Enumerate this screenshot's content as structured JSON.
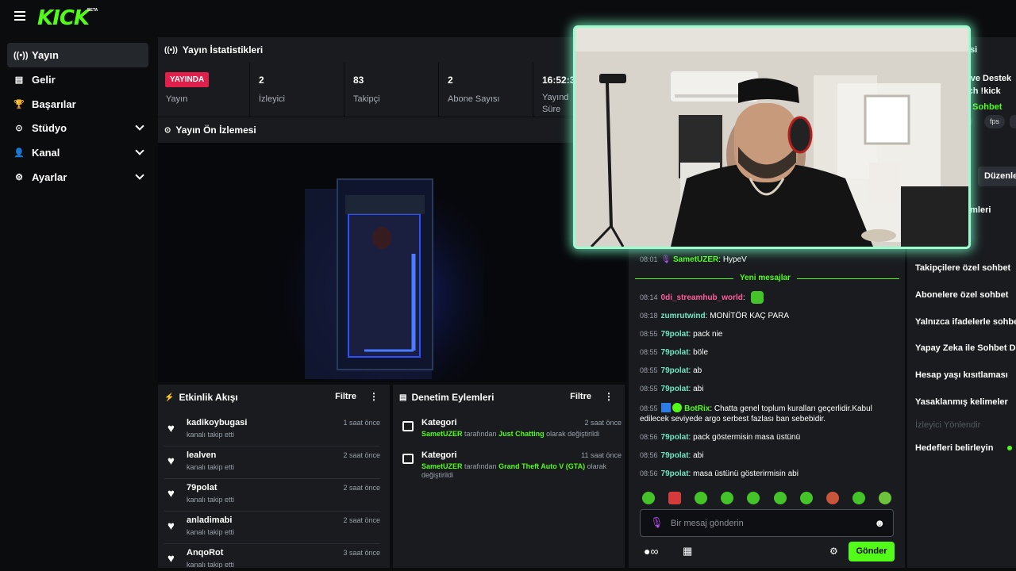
{
  "brand": {
    "logo": "KICK",
    "badge": "BETA"
  },
  "sidebar": {
    "items": [
      {
        "label": "Yayın",
        "icon": "broadcast-icon",
        "active": true
      },
      {
        "label": "Gelir",
        "icon": "revenue-icon"
      },
      {
        "label": "Başarılar",
        "icon": "trophy-icon"
      },
      {
        "label": "Stüdyo",
        "icon": "studio-icon",
        "expandable": true
      },
      {
        "label": "Kanal",
        "icon": "channel-icon",
        "expandable": true
      },
      {
        "label": "Ayarlar",
        "icon": "gear-icon",
        "expandable": true
      }
    ]
  },
  "stats": {
    "title": "Yayın İstatistikleri",
    "live_badge": "YAYINDA",
    "live_label": "Yayın",
    "viewers": {
      "value": "2",
      "label": "İzleyici"
    },
    "followers": {
      "value": "83",
      "label": "Takipçi"
    },
    "subs": {
      "value": "2",
      "label": "Abone Sayısı"
    },
    "duration": {
      "value": "16:52:3",
      "label1": "Yayınd",
      "label2": "Süre"
    }
  },
  "preview": {
    "title": "Yayın Ön İzlemesi"
  },
  "activity": {
    "title": "Etkinlik Akışı",
    "filter": "Filtre",
    "rows": [
      {
        "name": "kadikoybugasi",
        "sub": "kanalı takip etti",
        "time": "1 saat önce"
      },
      {
        "name": "lealven",
        "sub": "kanalı takip etti",
        "time": "2 saat önce"
      },
      {
        "name": "79polat",
        "sub": "kanalı takip etti",
        "time": "2 saat önce"
      },
      {
        "name": "anladimabi",
        "sub": "kanalı takip etti",
        "time": "2 saat önce"
      },
      {
        "name": "AnqoRot",
        "sub": "kanalı takip etti",
        "time": "3 saat önce"
      }
    ]
  },
  "moderation": {
    "title": "Denetim Eylemleri",
    "filter": "Filtre",
    "rows": [
      {
        "title": "Kategori",
        "time": "2 saat önce",
        "user": "SametUZER",
        "mid": "tarafından",
        "target": "Just Chatting",
        "tail": "olarak değiştirildi"
      },
      {
        "title": "Kategori",
        "time": "11 saat önce",
        "user": "SametUZER",
        "mid": "tarafından",
        "target": "Grand Theft Auto V (GTA)",
        "tail": "olarak değiştirildi"
      }
    ]
  },
  "chat": {
    "new_messages": "Yeni mesajlar",
    "messages": [
      {
        "time": "08:01",
        "user": "SametUZER",
        "text": "HypeV"
      },
      {
        "time": "08:14",
        "user": "0di_streamhub_world",
        "text": ""
      },
      {
        "time": "08:18",
        "user": "zumrutwind",
        "text": "MONİTÖR KAÇ PARA"
      },
      {
        "time": "08:55",
        "user": "79polat",
        "text": "pack nie"
      },
      {
        "time": "08:55",
        "user": "79polat",
        "text": "böle"
      },
      {
        "time": "08:55",
        "user": "79polat",
        "text": "ab"
      },
      {
        "time": "08:55",
        "user": "79polat",
        "text": "abi"
      },
      {
        "time": "08:55",
        "user": "BotRix",
        "text": "Chatta genel toplum kuralları geçerlidir.Kabul",
        "text2": "edilecek seviyede argo serbest fazlası ban sebebidir."
      },
      {
        "time": "08:56",
        "user": "79polat",
        "text": "pack göstermisin masa üstünü"
      },
      {
        "time": "08:56",
        "user": "79polat",
        "text": "abi"
      },
      {
        "time": "08:56",
        "user": "79polat",
        "text": "masa üstünü gösterirmisin abi"
      }
    ],
    "placeholder": "Bir mesaj gönderin",
    "send": "Gönder"
  },
  "right_panel": {
    "partial_title": "si",
    "partial1": "t ve Destek",
    "partial2": "tch !kick",
    "partial3": "e Sohbet",
    "tag1": "h",
    "tag2": "fps",
    "edit": "Düzenle",
    "partial4": "emleri",
    "items": [
      "Takipçilere özel sohbet",
      "Abonelere özel sohbet",
      "Yalnızca ifadelerle sohbet",
      "Yapay Zeka ile Sohbet De",
      "Hesap yaşı kısıtlaması",
      "Yasaklanmış kelimeler"
    ],
    "dim_item": "İzleyici Yönlendir",
    "last_item": "Hedefleri belirleyin"
  },
  "colors": {
    "brand": "#53fc18",
    "live": "#e0204a",
    "webcam_glow": "#9dfccf"
  }
}
